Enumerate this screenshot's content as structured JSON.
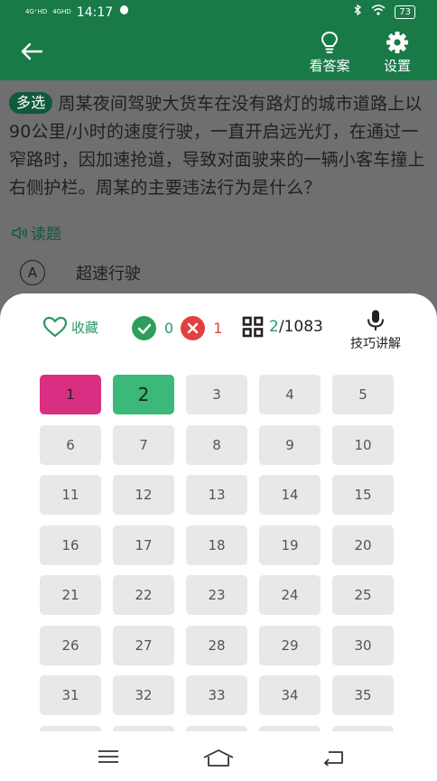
{
  "status": {
    "signal1": "4G⁺HD",
    "signal2": "4GHD",
    "time": "14:17",
    "battery": "73"
  },
  "appbar": {
    "answer_label": "看答案",
    "settings_label": "设置"
  },
  "question": {
    "tag": "多选",
    "text": "周某夜间驾驶大货车在没有路灯的城市道路上以90公里/小时的速度行驶，一直开启远光灯，在通过一窄路时，因加速抢道，导致对面驶来的一辆小客车撞上右侧护栏。周某的主要违法行为是什么？",
    "read_label": "读题"
  },
  "option_a": {
    "letter": "A",
    "text": "超速行驶"
  },
  "sheet": {
    "favorite_label": "收藏",
    "correct_count": "0",
    "wrong_count": "1",
    "current": "2",
    "total": "/1083",
    "tips_label": "技巧讲解"
  },
  "grid": {
    "columns": 5,
    "items": [
      {
        "n": "1",
        "state": "wrong"
      },
      {
        "n": "2",
        "state": "right"
      },
      {
        "n": "3",
        "state": "none"
      },
      {
        "n": "4",
        "state": "none"
      },
      {
        "n": "5",
        "state": "none"
      },
      {
        "n": "6",
        "state": "none"
      },
      {
        "n": "7",
        "state": "none"
      },
      {
        "n": "8",
        "state": "none"
      },
      {
        "n": "9",
        "state": "none"
      },
      {
        "n": "10",
        "state": "none"
      },
      {
        "n": "11",
        "state": "none"
      },
      {
        "n": "12",
        "state": "none"
      },
      {
        "n": "13",
        "state": "none"
      },
      {
        "n": "14",
        "state": "none"
      },
      {
        "n": "15",
        "state": "none"
      },
      {
        "n": "16",
        "state": "none"
      },
      {
        "n": "17",
        "state": "none"
      },
      {
        "n": "18",
        "state": "none"
      },
      {
        "n": "19",
        "state": "none"
      },
      {
        "n": "20",
        "state": "none"
      },
      {
        "n": "21",
        "state": "none"
      },
      {
        "n": "22",
        "state": "none"
      },
      {
        "n": "23",
        "state": "none"
      },
      {
        "n": "24",
        "state": "none"
      },
      {
        "n": "25",
        "state": "none"
      },
      {
        "n": "26",
        "state": "none"
      },
      {
        "n": "27",
        "state": "none"
      },
      {
        "n": "28",
        "state": "none"
      },
      {
        "n": "29",
        "state": "none"
      },
      {
        "n": "30",
        "state": "none"
      },
      {
        "n": "31",
        "state": "none"
      },
      {
        "n": "32",
        "state": "none"
      },
      {
        "n": "33",
        "state": "none"
      },
      {
        "n": "34",
        "state": "none"
      },
      {
        "n": "35",
        "state": "none"
      },
      {
        "n": "",
        "state": "none"
      },
      {
        "n": "",
        "state": "none"
      },
      {
        "n": "",
        "state": "none"
      },
      {
        "n": "",
        "state": "none"
      },
      {
        "n": "",
        "state": "none"
      }
    ]
  },
  "colors": {
    "primary": "#197a48",
    "accent": "#2a9a63",
    "wrong": "#d92f83",
    "right": "#3cb878"
  }
}
